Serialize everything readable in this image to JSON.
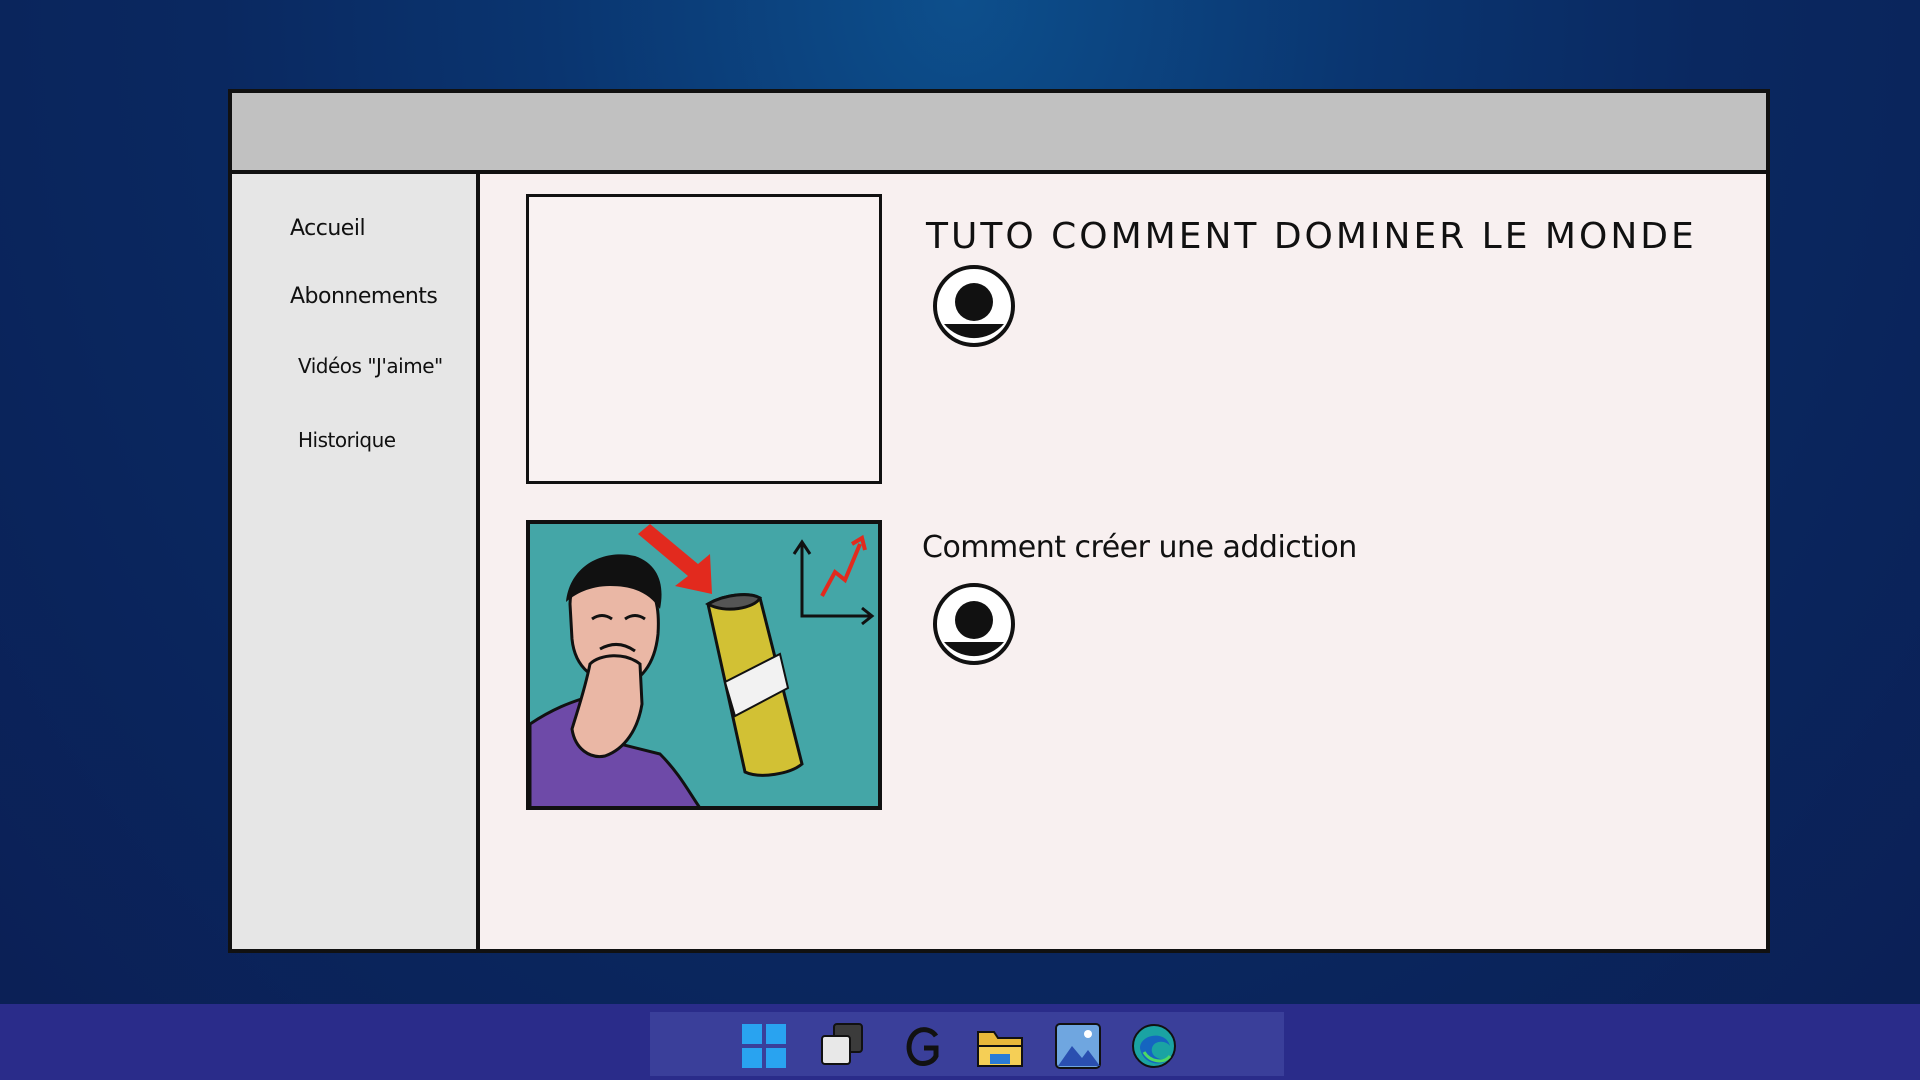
{
  "sidebar": {
    "items": [
      {
        "label": "Accueil"
      },
      {
        "label": "Abonnements"
      },
      {
        "label": "Vidéos \"J'aime\""
      },
      {
        "label": "Historique"
      }
    ]
  },
  "videos": [
    {
      "title": "TUTO COMMENT DOMINER LE MONDE",
      "thumbnail": "blank"
    },
    {
      "title": "Comment créer une addiction",
      "thumbnail": "man-thinking-with-can-and-rising-chart"
    }
  ],
  "taskbar": {
    "icons": [
      "windows-start-icon",
      "task-view-icon",
      "google-icon",
      "file-explorer-icon",
      "photos-icon",
      "edge-browser-icon"
    ]
  },
  "colors": {
    "desktop_background": "#0a2a63",
    "window_content": "#f8f0f0",
    "sidebar": "#e6e6e6",
    "titlebar": "#c1c1c1",
    "taskbar": "#2a2c8a",
    "thumbnail_background": "#44a6a7"
  }
}
